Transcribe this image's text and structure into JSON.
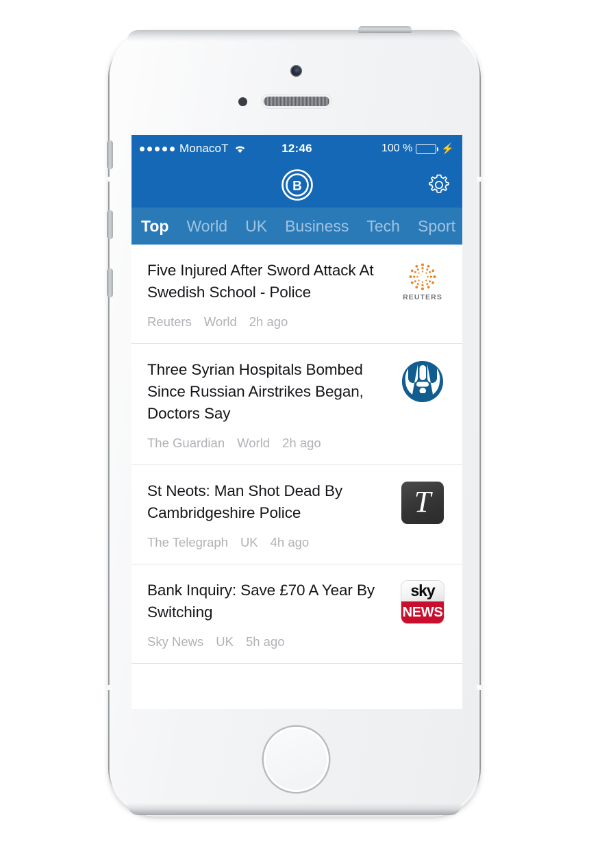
{
  "status_bar": {
    "signal_dots": 5,
    "carrier": "MonacoT",
    "wifi_icon": "wifi-icon",
    "time": "12:46",
    "battery_percent": "100 %",
    "battery_level": 100,
    "charging_icon": "lightning-bolt-icon",
    "battery_color": "#4ce04c"
  },
  "nav_bar": {
    "logo_icon": "app-logo-b-icon",
    "logo_letter": "B",
    "settings_icon": "gear-icon",
    "background_color": "#1568b5"
  },
  "tabs": {
    "background_color": "#2a7ab8",
    "active_index": 0,
    "items": [
      {
        "label": "Top"
      },
      {
        "label": "World"
      },
      {
        "label": "UK"
      },
      {
        "label": "Business"
      },
      {
        "label": "Tech"
      },
      {
        "label": "Sport"
      }
    ]
  },
  "articles": [
    {
      "title": "Five Injured After Sword Attack At Swedish School - Police",
      "source": "Reuters",
      "category": "World",
      "time_ago": "2h ago",
      "logo": "reuters-logo",
      "logo_wordmark": "REUTERS",
      "logo_color": "#ee8422"
    },
    {
      "title": "Three Syrian Hospitals Bombed Since Russian Airstrikes Began, Doctors Say",
      "source": "The Guardian",
      "category": "World",
      "time_ago": "2h ago",
      "logo": "guardian-logo",
      "logo_color": "#125d8f"
    },
    {
      "title": "St Neots: Man Shot Dead By Cambridgeshire Police",
      "source": "The Telegraph",
      "category": "UK",
      "time_ago": "4h ago",
      "logo": "telegraph-logo",
      "logo_letter": "T",
      "logo_color": "#333333"
    },
    {
      "title": "Bank Inquiry: Save £70 A Year By Switching",
      "source": "Sky News",
      "category": "UK",
      "time_ago": "5h ago",
      "logo": "sky-news-logo",
      "logo_top_text": "sky",
      "logo_bottom_text": "NEWS",
      "logo_color": "#c8102e"
    }
  ],
  "device": {
    "camera_icon": "front-camera-icon",
    "sensor_icon": "proximity-sensor-icon",
    "speaker_icon": "earpiece-speaker-icon",
    "home_button_icon": "home-button-icon",
    "power_button_icon": "power-button-icon",
    "silent_switch_icon": "silent-switch-icon",
    "volume_up_icon": "volume-up-button-icon",
    "volume_down_icon": "volume-down-button-icon"
  }
}
